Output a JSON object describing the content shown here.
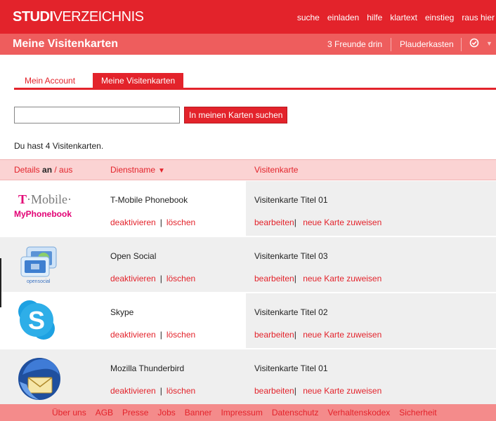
{
  "app": {
    "logo_bold": "STUDI",
    "logo_thin": "VERZEICHNIS"
  },
  "topnav": [
    "suche",
    "einladen",
    "hilfe",
    "klartext",
    "einstieg",
    "raus hier"
  ],
  "titlebar": {
    "title": "Meine Visitenkarten",
    "friends": "3 Freunde drin",
    "chat": "Plauderkasten"
  },
  "tabs": [
    {
      "label": "Mein Account",
      "active": false
    },
    {
      "label": "Meine Visitenkarten",
      "active": true
    }
  ],
  "search": {
    "value": "",
    "placeholder": "",
    "button": "In meinen Karten suchen"
  },
  "count_text": "Du hast 4 Visitenkarten.",
  "table": {
    "details_prefix": "Details ",
    "details_on": "an",
    "details_sep": " / ",
    "details_off": "aus",
    "col_service": "Dienstname",
    "col_card": "Visitenkarte",
    "rows": [
      {
        "service": "T-Mobile Phonebook",
        "card": "Visitenkarte Titel 01",
        "logo": "tmobile-logo",
        "logo_word": "·Mobile·",
        "logo_sub": "MyPhonebook"
      },
      {
        "service": "Open Social",
        "card": "Visitenkarte Titel 03",
        "logo": "opensocial-logo",
        "logo_sub": "opensocial"
      },
      {
        "service": "Skype",
        "card": "Visitenkarte Titel 02",
        "logo": "skype-logo"
      },
      {
        "service": "Mozilla Thunderbird",
        "card": "Visitenkarte Titel 01",
        "logo": "thunderbird-logo"
      }
    ],
    "deactivate": "deaktivieren",
    "delete": "löschen",
    "edit": "bearbeiten",
    "assign": "neue Karte zuweisen",
    "pipe": "|"
  },
  "footer": [
    "Über uns",
    "AGB",
    "Presse",
    "Jobs",
    "Banner",
    "Impressum",
    "Datenschutz",
    "Verhaltenskodex",
    "Sicherheit"
  ],
  "colors": {
    "brand_red": "#e3232b",
    "title_bar": "#ee5d5d",
    "table_header": "#fbd3d3",
    "footer": "#f48b8b",
    "telekom_magenta": "#e20074"
  }
}
